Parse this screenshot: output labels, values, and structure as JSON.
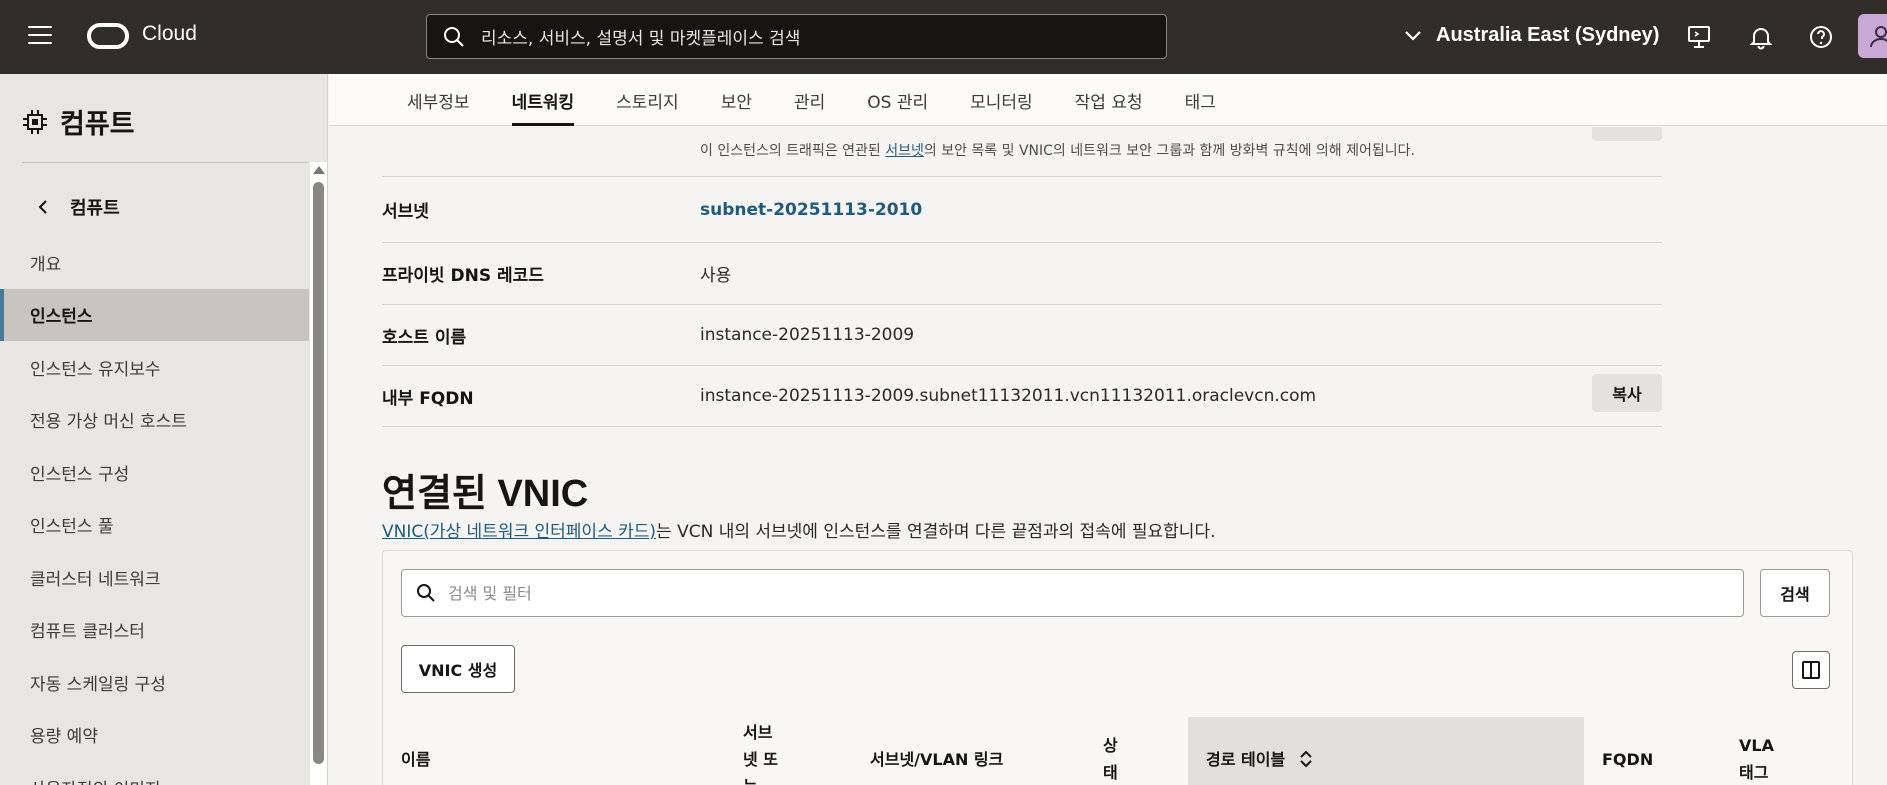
{
  "topbar": {
    "brand": "Cloud",
    "search_placeholder": "리소스, 서비스, 설명서 및 마켓플레이스 검색",
    "region": "Australia East (Sydney)"
  },
  "sidebar": {
    "title": "컴퓨트",
    "back_label": "컴퓨트",
    "items": [
      {
        "label": "개요"
      },
      {
        "label": "인스턴스"
      },
      {
        "label": "인스턴스 유지보수"
      },
      {
        "label": "전용 가상 머신 호스트"
      },
      {
        "label": "인스턴스 구성"
      },
      {
        "label": "인스턴스 풀"
      },
      {
        "label": "클러스터 네트워크"
      },
      {
        "label": "컴퓨트 클러스터"
      },
      {
        "label": "자동 스케일링 구성"
      },
      {
        "label": "용량 예약"
      },
      {
        "label": "사용자정의 이미지"
      }
    ]
  },
  "tabs": [
    "세부정보",
    "네트워킹",
    "스토리지",
    "보안",
    "관리",
    "OS 관리",
    "모니터링",
    "작업 요청",
    "태그"
  ],
  "details": {
    "firewall_note_prefix": "이 인스턴스의 트래픽은 연관된 ",
    "firewall_note_link": "서브넷",
    "firewall_note_suffix": "의 보안 목록 및 VNIC의 네트워크 보안 그룹과 함께 방화벽 규칙에 의해 제어됩니다.",
    "rows": [
      {
        "key": "서브넷",
        "value": "subnet-20251113-2010"
      },
      {
        "key": "프라이빗 DNS 레코드",
        "value": "사용"
      },
      {
        "key": "호스트 이름",
        "value": "instance-20251113-2009"
      },
      {
        "key": "내부 FQDN",
        "value": "instance-20251113-2009.subnet11132011.vcn11132011.oraclevcn.com"
      }
    ],
    "copy_label": "복사"
  },
  "vnic": {
    "title": "연결된 VNIC",
    "desc_link": "VNIC(가상 네트워크 인터페이스 카드)",
    "desc_rest": "는 VCN 내의 서브넷에 인스턴스를 연결하며 다른 끝점과의 접속에 필요합니다.",
    "filter_placeholder": "검색 및 필터",
    "search_label": "검색",
    "create_label": "VNIC 생성",
    "columns": {
      "name": "이름",
      "subnet_or_vlan": "서브\n넷 또\n는",
      "subnet_link": "서브넷/VLAN 링크",
      "state": "상\n태",
      "route_table": "경로 테이블",
      "fqdn": "FQDN",
      "vlan_tag": "VLA\n태그"
    }
  }
}
